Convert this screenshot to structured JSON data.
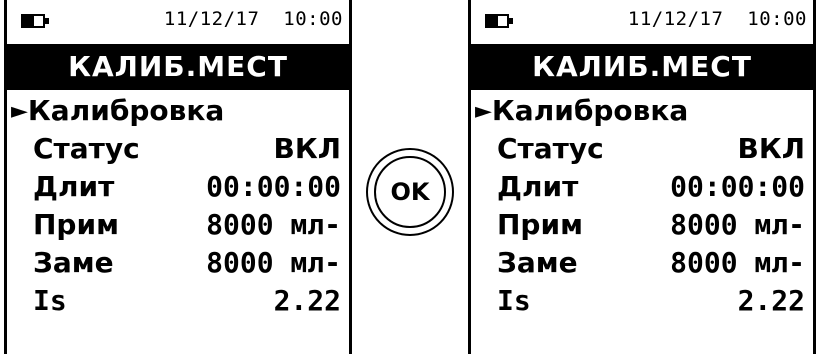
{
  "screens": [
    {
      "status": {
        "battery_icon": "battery-icon",
        "datetime": "11/12/17  10:00"
      },
      "title": "КАЛИБ.МЕСТ",
      "menu": [
        {
          "cursor": "►",
          "label": "Калибровка",
          "value": ""
        },
        {
          "label": "Статус",
          "value": "ВКЛ"
        },
        {
          "label": "Длит",
          "value": "00:00:00"
        },
        {
          "label": "Прим",
          "value": "8000 мл-"
        },
        {
          "label": "Заме",
          "value": "8000 мл-"
        },
        {
          "label": "Is",
          "value": "2.22"
        }
      ]
    },
    {
      "status": {
        "battery_icon": "battery-icon",
        "datetime": "11/12/17  10:00"
      },
      "title": "КАЛИБ.МЕСТ",
      "menu": [
        {
          "cursor": "►",
          "label": "Калибровка",
          "value": ""
        },
        {
          "label": "Статус",
          "value": "ВКЛ"
        },
        {
          "label": "Длит",
          "value": "00:00:00"
        },
        {
          "label": "Прим",
          "value": "8000 мл-"
        },
        {
          "label": "Заме",
          "value": "8000 мл-"
        },
        {
          "label": "Is",
          "value": "2.22"
        }
      ]
    }
  ],
  "ok_button": {
    "label": "OK"
  }
}
